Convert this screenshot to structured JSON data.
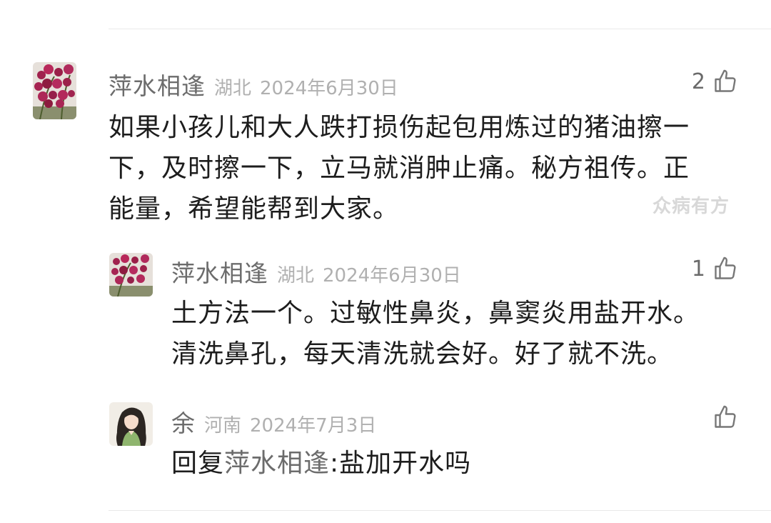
{
  "comments": [
    {
      "author": "萍水相逢",
      "region": "湖北",
      "date": "2024年6月30日",
      "likes": "2",
      "lines": [
        "如果小孩儿和大人跌打损伤起包用炼过的猪油擦一",
        "下，及时擦一下，立马就消肿止痛。秘方祖传。正",
        "能量，希望能帮到大家。"
      ]
    },
    {
      "author": "萍水相逢",
      "region": "湖北",
      "date": "2024年6月30日",
      "likes": "1",
      "lines": [
        "土方法一个。过敏性鼻炎，鼻窦炎用盐开水。",
        "清洗鼻孔，每天清洗就会好。好了就不洗。"
      ]
    },
    {
      "author": "余",
      "region": "河南",
      "date": "2024年7月3日",
      "likes": "",
      "reply_prefix": "回复",
      "reply_to": "萍水相逢",
      "reply_text": ":盐加开水吗"
    }
  ],
  "watermark": "众病有方",
  "icons": {
    "like": "thumbs-up-icon",
    "avatar_flower": "orchid-photo",
    "avatar_girl": "illustrated-girl"
  },
  "colors": {
    "name": "#6c6c6c",
    "meta": "#b0b0b0",
    "text": "#1d1d1d",
    "watermark": "#d8d8d8"
  }
}
